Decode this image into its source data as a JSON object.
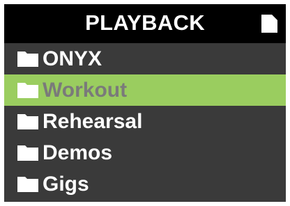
{
  "header": {
    "title": "PLAYBACK",
    "icon": "file-icon"
  },
  "list": {
    "items": [
      {
        "label": "ONYX",
        "icon": "folder-icon",
        "selected": false
      },
      {
        "label": "Workout",
        "icon": "folder-icon",
        "selected": true
      },
      {
        "label": "Rehearsal",
        "icon": "folder-icon",
        "selected": false
      },
      {
        "label": "Demos",
        "icon": "folder-icon",
        "selected": false
      },
      {
        "label": "Gigs",
        "icon": "folder-icon",
        "selected": false
      }
    ]
  },
  "colors": {
    "background": "#3a3a3a",
    "header_background": "#000000",
    "highlight": "#9acd5f",
    "text": "#ffffff",
    "selected_text": "#7a7a7a"
  }
}
